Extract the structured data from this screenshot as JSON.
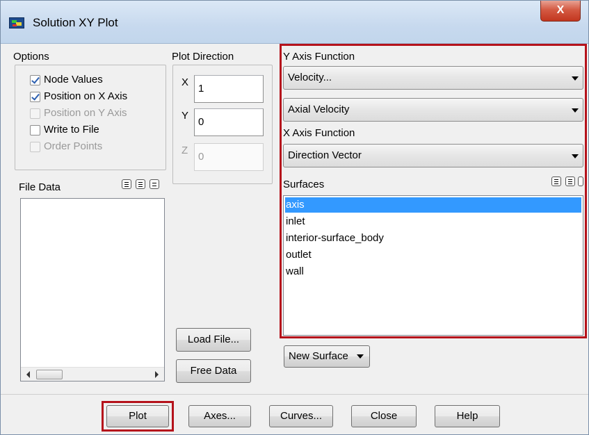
{
  "window": {
    "title": "Solution XY Plot",
    "close_glyph": "X"
  },
  "options": {
    "title": "Options",
    "items": [
      {
        "label": "Node Values",
        "checked": true,
        "enabled": true
      },
      {
        "label": "Position on X Axis",
        "checked": true,
        "enabled": true
      },
      {
        "label": "Position on Y Axis",
        "checked": false,
        "enabled": false
      },
      {
        "label": "Write to File",
        "checked": false,
        "enabled": true
      },
      {
        "label": "Order Points",
        "checked": false,
        "enabled": false
      }
    ]
  },
  "plot_direction": {
    "title": "Plot Direction",
    "x_label": "X",
    "x_value": "1",
    "y_label": "Y",
    "y_value": "0",
    "z_label": "Z",
    "z_value": "0"
  },
  "file_data": {
    "title": "File Data",
    "load_file_label": "Load File...",
    "free_data_label": "Free Data"
  },
  "y_axis_function": {
    "title": "Y Axis Function",
    "category": "Velocity...",
    "quantity": "Axial Velocity"
  },
  "x_axis_function": {
    "title": "X Axis Function",
    "value": "Direction Vector"
  },
  "surfaces": {
    "title": "Surfaces",
    "items": [
      "axis",
      "inlet",
      "interior-surface_body",
      "outlet",
      "wall"
    ],
    "selected_index": 0,
    "new_surface_label": "New Surface"
  },
  "footer": {
    "plot_label": "Plot",
    "axes_label": "Axes...",
    "curves_label": "Curves...",
    "close_label": "Close",
    "help_label": "Help"
  },
  "colors": {
    "highlight_box": "#b5121b",
    "selection": "#3399ff"
  }
}
